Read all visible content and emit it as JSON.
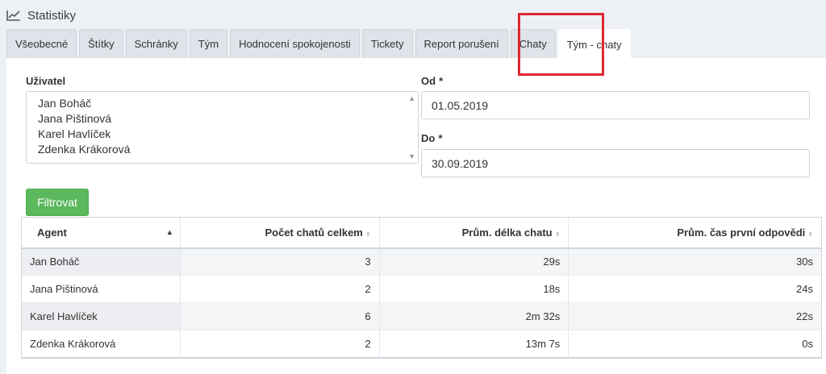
{
  "header": {
    "icon": "line-chart-icon",
    "title": "Statistiky"
  },
  "tabs": [
    {
      "label": "Všeobecné",
      "active": false
    },
    {
      "label": "Štítky",
      "active": false
    },
    {
      "label": "Schránky",
      "active": false
    },
    {
      "label": "Tým",
      "active": false
    },
    {
      "label": "Hodnocení spokojenosti",
      "active": false
    },
    {
      "label": "Tickety",
      "active": false
    },
    {
      "label": "Report porušení",
      "active": false
    },
    {
      "label": "Chaty",
      "active": false
    },
    {
      "label": "Tým - chaty",
      "active": true
    }
  ],
  "filters": {
    "user_label": "Uživatel",
    "users": [
      "Jan Boháč",
      "Jana Pištinová",
      "Karel Havlíček",
      "Zdenka Krákorová"
    ],
    "from_label": "Od",
    "from_value": "01.05.2019",
    "to_label": "Do",
    "to_value": "30.09.2019",
    "required_mark": "*",
    "filter_button": "Filtrovat"
  },
  "table": {
    "columns": [
      "Agent",
      "Počet chatů celkem",
      "Prům. délka chatu",
      "Prům. čas první odpovědi"
    ],
    "rows": [
      [
        "Jan Boháč",
        "3",
        "29s",
        "30s"
      ],
      [
        "Jana Pištinová",
        "2",
        "18s",
        "24s"
      ],
      [
        "Karel Havlíček",
        "6",
        "2m 32s",
        "22s"
      ],
      [
        "Zdenka Krákorová",
        "2",
        "13m 7s",
        "0s"
      ]
    ]
  },
  "colors": {
    "accent_green": "#5cb85c",
    "highlight_red": "#e0262f",
    "background": "#edf0f5"
  }
}
